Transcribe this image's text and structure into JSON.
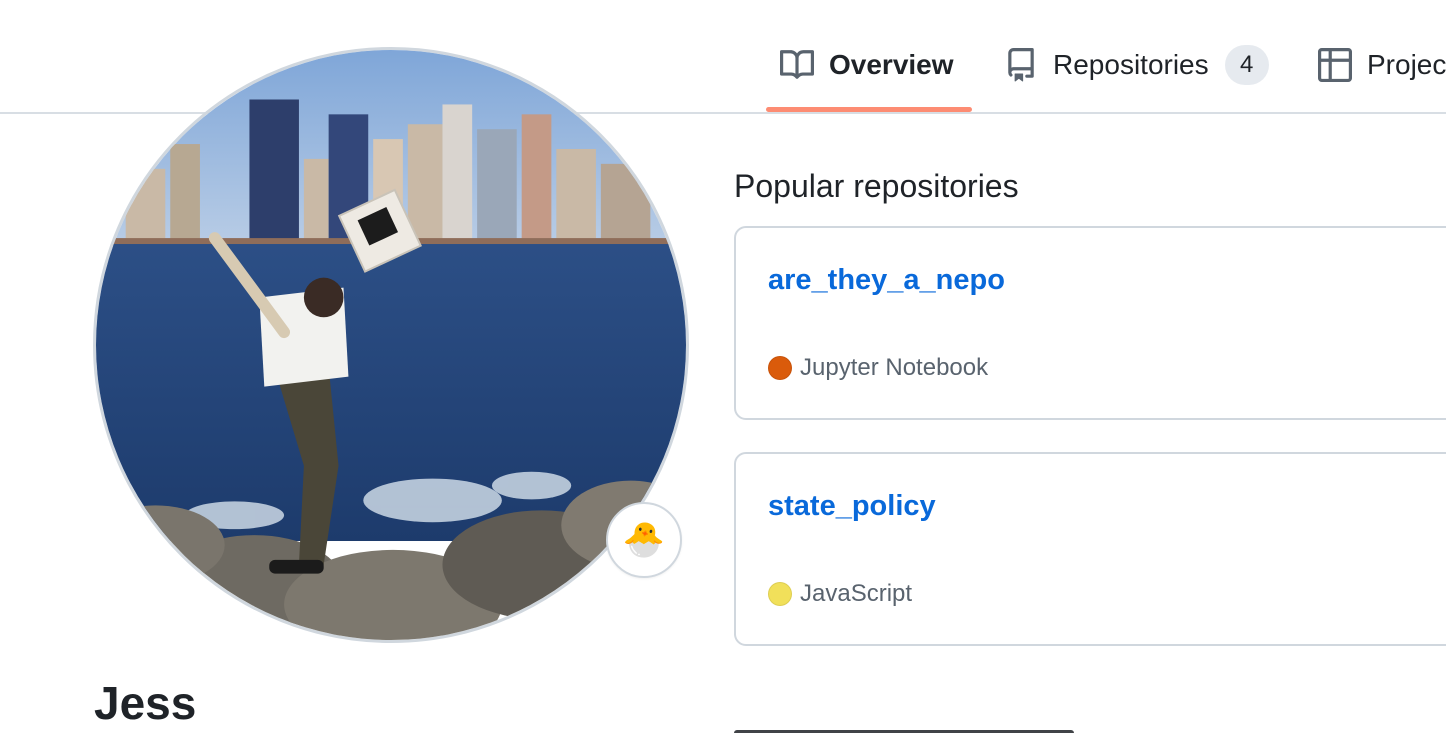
{
  "tabs": [
    {
      "label": "Overview",
      "icon": "book-icon",
      "active": true
    },
    {
      "label": "Repositories",
      "icon": "repo-icon",
      "count": "4"
    },
    {
      "label": "Projec",
      "icon": "table-icon"
    }
  ],
  "profile": {
    "name": "Jess",
    "avatar": "avatar-image",
    "status_emoji": "🐣"
  },
  "popular": {
    "title": "Popular repositories",
    "repos": [
      {
        "name": "are_they_a_nepo",
        "language": "Jupyter Notebook",
        "language_color": "#DA5B0B"
      },
      {
        "name": "state_policy",
        "language": "JavaScript",
        "language_color": "#f1e05a"
      }
    ]
  },
  "colors": {
    "link": "#0969da",
    "tab_underline": "#fd8c73",
    "border": "#d0d7de",
    "text": "#1f2328",
    "muted": "#59636e"
  }
}
